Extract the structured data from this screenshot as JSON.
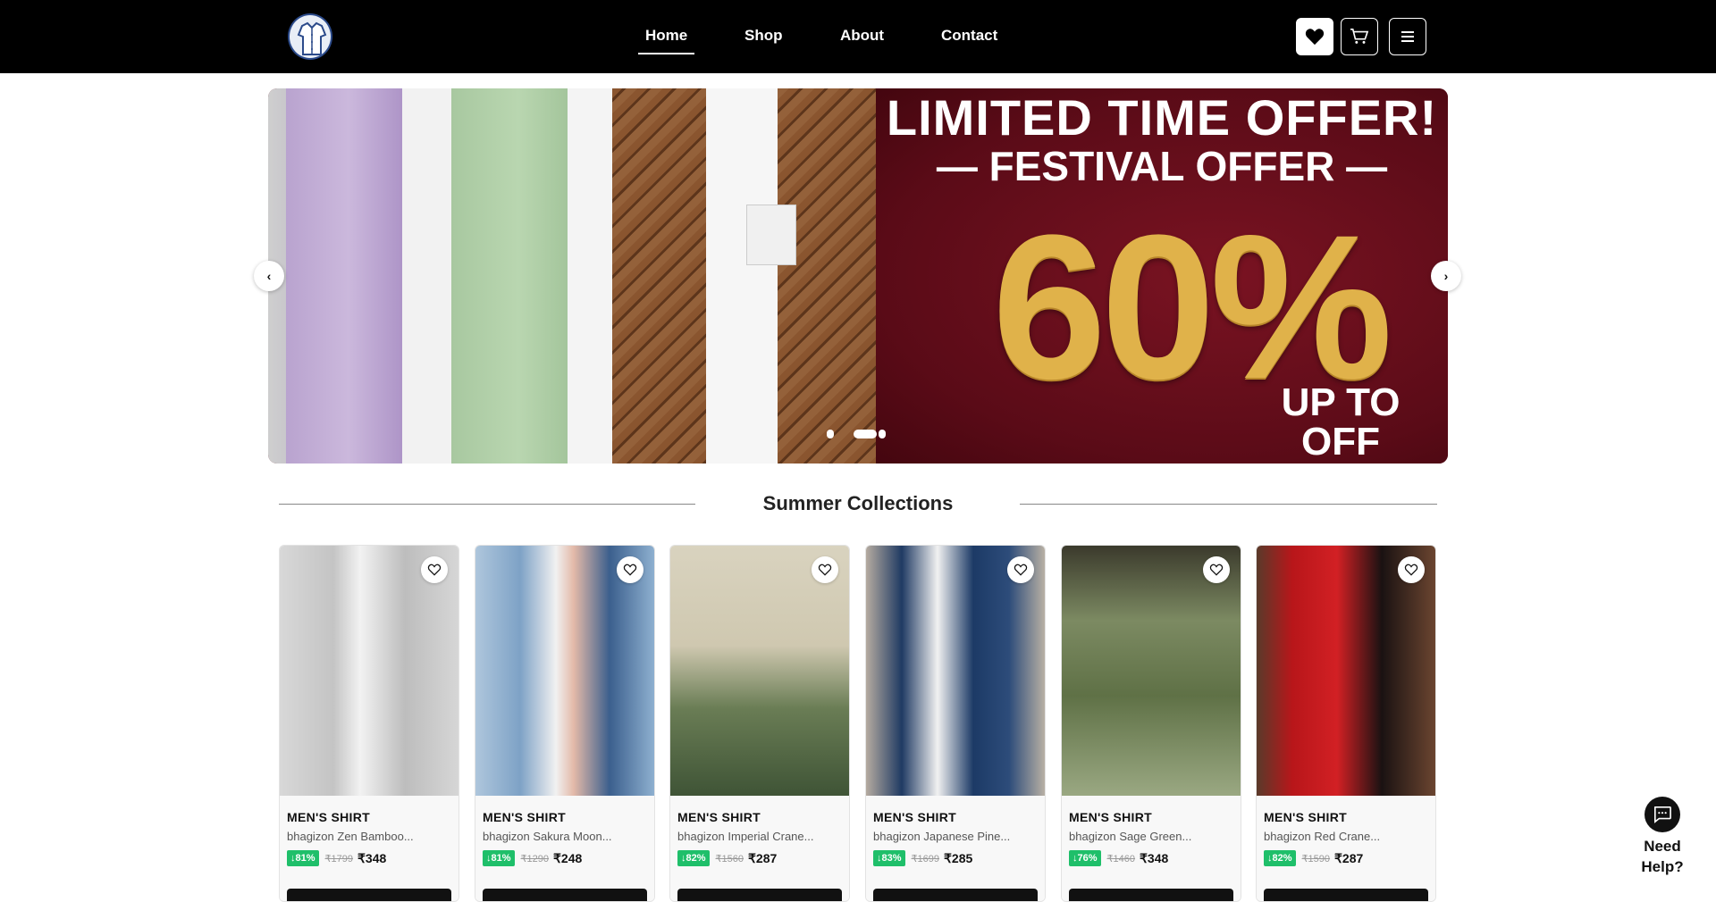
{
  "header": {
    "nav": [
      {
        "label": "Home"
      },
      {
        "label": "Shop"
      },
      {
        "label": "About"
      },
      {
        "label": "Contact"
      }
    ],
    "icons": [
      "heart-icon",
      "cart-icon",
      "menu-icon"
    ]
  },
  "banner": {
    "title_line1": "LIMITED TIME OFFER!",
    "title_line2": "— FESTIVAL OFFER —",
    "big_number": "60%",
    "upto_line1": "UP TO",
    "upto_line2": "OFF",
    "prev_label": "‹",
    "next_label": "›",
    "slide_count": 3,
    "active_slide": 2
  },
  "section": {
    "title": "Summer Collections"
  },
  "products": [
    {
      "category": "MEN'S SHIRT",
      "name": "bhagizon Zen Bamboo...",
      "discount": "↓81%",
      "mrp": "₹1799",
      "price": "₹348"
    },
    {
      "category": "MEN'S SHIRT",
      "name": "bhagizon Sakura Moon...",
      "discount": "↓81%",
      "mrp": "₹1290",
      "price": "₹248"
    },
    {
      "category": "MEN'S SHIRT",
      "name": "bhagizon Imperial Crane...",
      "discount": "↓82%",
      "mrp": "₹1560",
      "price": "₹287"
    },
    {
      "category": "MEN'S SHIRT",
      "name": "bhagizon Japanese Pine...",
      "discount": "↓83%",
      "mrp": "₹1699",
      "price": "₹285"
    },
    {
      "category": "MEN'S SHIRT",
      "name": "bhagizon Sage Green...",
      "discount": "↓76%",
      "mrp": "₹1460",
      "price": "₹348"
    },
    {
      "category": "MEN'S SHIRT",
      "name": "bhagizon Red Crane...",
      "discount": "↓82%",
      "mrp": "₹1590",
      "price": "₹287"
    }
  ],
  "help": {
    "line1": "Need",
    "line2": "Help?"
  },
  "colors": {
    "header_bg": "#000000",
    "discount_badge": "#1fbf6a",
    "banner_bg": "#6b0e1c",
    "gold": "#e0b24a"
  }
}
